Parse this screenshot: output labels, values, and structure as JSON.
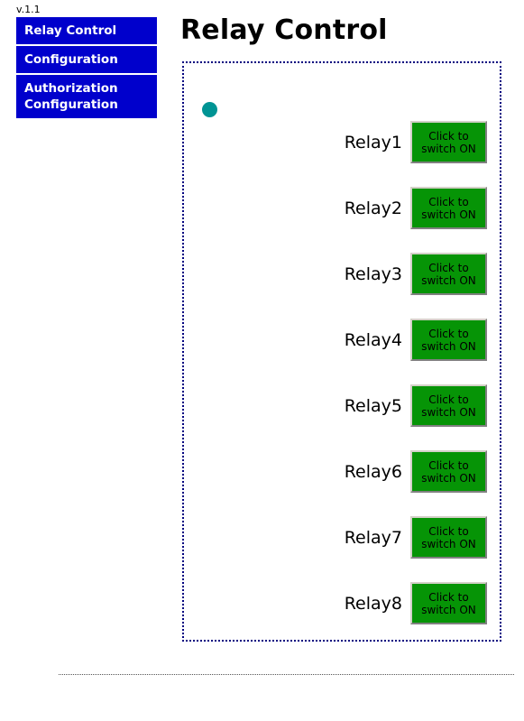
{
  "app": {
    "version_label": "v.1.1",
    "page_title": "Relay Control"
  },
  "sidebar": {
    "items": [
      {
        "label": "Relay Control",
        "active": true
      },
      {
        "label": "Configuration",
        "active": false
      },
      {
        "label": "Authorization\nConfiguration",
        "active": false
      }
    ]
  },
  "panel": {
    "status_indicator": {
      "name": "status-indicator",
      "color": "#009494",
      "state": "on"
    },
    "button_color": "#069406",
    "border_color": "#000080",
    "relays": [
      {
        "label": "Relay1",
        "button_label": "Click to\nswitch ON"
      },
      {
        "label": "Relay2",
        "button_label": "Click to\nswitch ON"
      },
      {
        "label": "Relay3",
        "button_label": "Click to\nswitch ON"
      },
      {
        "label": "Relay4",
        "button_label": "Click to\nswitch ON"
      },
      {
        "label": "Relay5",
        "button_label": "Click to\nswitch ON"
      },
      {
        "label": "Relay6",
        "button_label": "Click to\nswitch ON"
      },
      {
        "label": "Relay7",
        "button_label": "Click to\nswitch ON"
      },
      {
        "label": "Relay8",
        "button_label": "Click to\nswitch ON"
      }
    ]
  },
  "colors": {
    "nav_background": "#0000cc",
    "nav_text": "#ffffff",
    "accent_green": "#069406",
    "accent_teal": "#009494",
    "panel_border": "#000080"
  }
}
